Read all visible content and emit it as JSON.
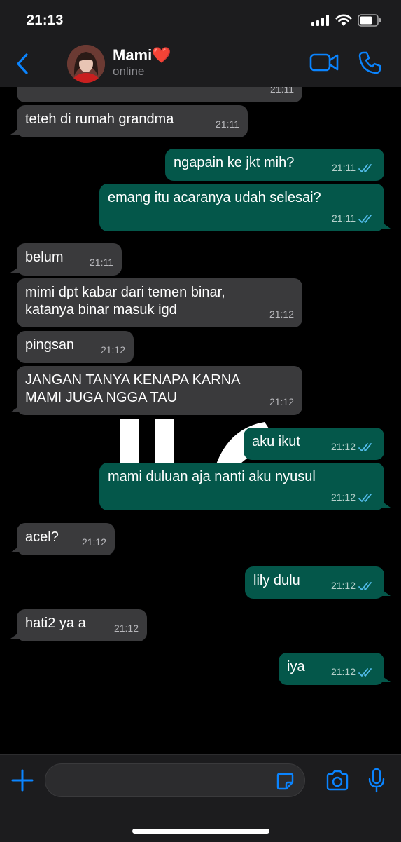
{
  "status_bar": {
    "time": "21:13"
  },
  "header": {
    "contact_name": "Mami❤️",
    "contact_status": "online"
  },
  "messages": [
    {
      "text": "teteh di rumah grandma",
      "time": "21:11",
      "direction": "in"
    },
    {
      "text": "ngapain ke jkt mih?",
      "time": "21:11",
      "direction": "out",
      "read": true
    },
    {
      "text": "emang itu acaranya udah selesai?",
      "time": "21:11",
      "direction": "out",
      "read": true
    },
    {
      "text": "belum",
      "time": "21:11",
      "direction": "in"
    },
    {
      "text": "mimi dpt kabar dari temen binar,\nkatanya binar masuk igd",
      "time": "21:12",
      "direction": "in"
    },
    {
      "text": "pingsan",
      "time": "21:12",
      "direction": "in"
    },
    {
      "text": "JANGAN TANYA KENAPA KARNA\nMAMI JUGA NGGA TAU",
      "time": "21:12",
      "direction": "in"
    },
    {
      "text": "aku ikut",
      "time": "21:12",
      "direction": "out",
      "read": true
    },
    {
      "text": "mami duluan aja nanti aku nyusul",
      "time": "21:12",
      "direction": "out",
      "read": true
    },
    {
      "text": "acel?",
      "time": "21:12",
      "direction": "in"
    },
    {
      "text": "lily dulu",
      "time": "21:12",
      "direction": "out",
      "read": true
    },
    {
      "text": "hati2 ya a",
      "time": "21:12",
      "direction": "in"
    },
    {
      "text": "iya",
      "time": "21:12",
      "direction": "out",
      "read": true
    }
  ],
  "partial_top_message": {
    "time": "21:11"
  },
  "composer": {
    "value": ""
  },
  "colors": {
    "accent": "#0a84ff",
    "incoming_bubble": "#3a3a3c",
    "outgoing_bubble": "#04574a",
    "read_ticks": "#53bdeb"
  }
}
